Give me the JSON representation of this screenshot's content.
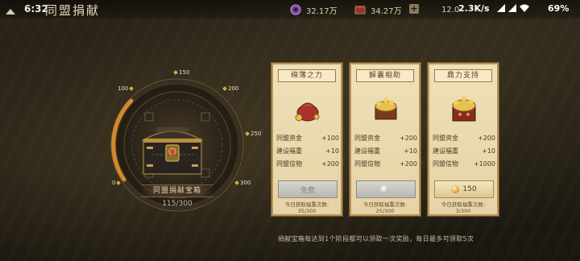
{
  "status_bar": {
    "time": "6:32",
    "network_speed": "2.3K/s",
    "battery": "69"
  },
  "header": {
    "title": "同盟捐献",
    "resources": [
      {
        "icon": "purple-coin-icon",
        "value": "32.17万"
      },
      {
        "icon": "red-box-icon",
        "value": "34.27万"
      },
      {
        "icon": "gold-coin-icon",
        "value": "12.0"
      }
    ]
  },
  "dial": {
    "milestones": [
      "0",
      "100",
      "150",
      "200",
      "250",
      "300"
    ],
    "chest_label": "同盟捐献宝箱",
    "progress": "115/300",
    "progress_value": 115,
    "progress_max": 300
  },
  "cards": [
    {
      "title": "绵薄之力",
      "rows": [
        {
          "label": "同盟资金",
          "value": "+100"
        },
        {
          "label": "建设福重",
          "value": "+10"
        },
        {
          "label": "同盟信物",
          "value": "+200"
        }
      ],
      "button_text": "免费",
      "button_style": "gray",
      "count_label": "今日获取福重次数:",
      "count_value": "35/300"
    },
    {
      "title": "解囊相助",
      "rows": [
        {
          "label": "同盟资金",
          "value": "+200"
        },
        {
          "label": "建设福重",
          "value": "+10"
        },
        {
          "label": "同盟信物",
          "value": "+200"
        }
      ],
      "button_text": "",
      "button_style": "gray",
      "count_label": "今日获取福重次数:",
      "count_value": "25/300"
    },
    {
      "title": "鼎力支持",
      "rows": [
        {
          "label": "同盟资金",
          "value": "+200"
        },
        {
          "label": "建设福重",
          "value": "+10"
        },
        {
          "label": "同盟信物",
          "value": "+1000"
        }
      ],
      "button_text": "150",
      "button_style": "gold",
      "count_label": "今日获取福重次数:",
      "count_value": "3/300"
    }
  ],
  "footer": "捐献宝箱每达到1个阶段都可以领取一次奖励，每日最多可领取5次",
  "colors": {
    "accent_gold": "#d4a94a",
    "card_bg": "#e6d3a6",
    "text_brown": "#4a3a22"
  }
}
